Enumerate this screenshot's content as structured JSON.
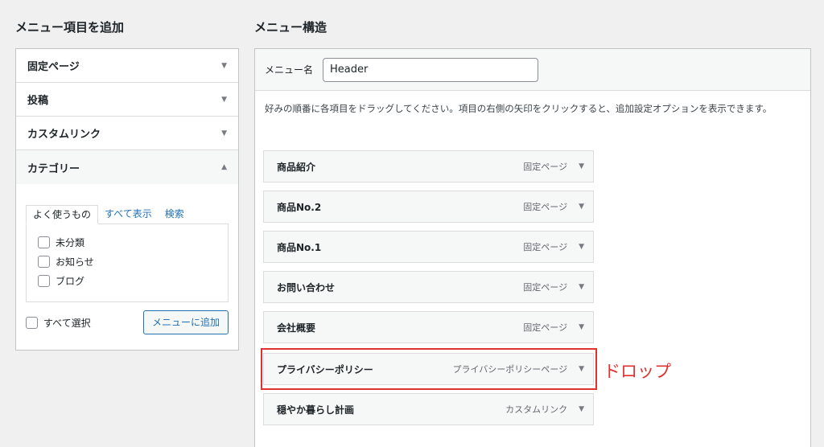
{
  "left": {
    "heading": "メニュー項目を追加",
    "accordion": [
      {
        "label": "固定ページ",
        "arrow": "▼"
      },
      {
        "label": "投稿",
        "arrow": "▼"
      },
      {
        "label": "カスタムリンク",
        "arrow": "▼"
      },
      {
        "label": "カテゴリー",
        "arrow": "▲"
      }
    ],
    "tabs": [
      "よく使うもの",
      "すべて表示",
      "検索"
    ],
    "categories": [
      "未分類",
      "お知らせ",
      "ブログ"
    ],
    "select_all": "すべて選択",
    "add_button": "メニューに追加"
  },
  "right": {
    "heading": "メニュー構造",
    "menu_name_label": "メニュー名",
    "menu_name_value": "Header",
    "instructions": "好みの順番に各項目をドラッグしてください。項目の右側の矢印をクリックすると、追加設定オプションを表示できます。",
    "items": [
      {
        "title": "商品紹介",
        "type": "固定ページ"
      },
      {
        "title": "商品No.2",
        "type": "固定ページ"
      },
      {
        "title": "商品No.1",
        "type": "固定ページ"
      },
      {
        "title": "お問い合わせ",
        "type": "固定ページ"
      },
      {
        "title": "会社概要",
        "type": "固定ページ"
      },
      {
        "title": "プライバシーポリシー",
        "type": "プライバシーポリシーページ"
      },
      {
        "title": "穏やか暮らし計画",
        "type": "カスタムリンク"
      }
    ],
    "item_arrow": "▼"
  },
  "annotation": {
    "label": "ドロップ",
    "color": "#e03131"
  }
}
